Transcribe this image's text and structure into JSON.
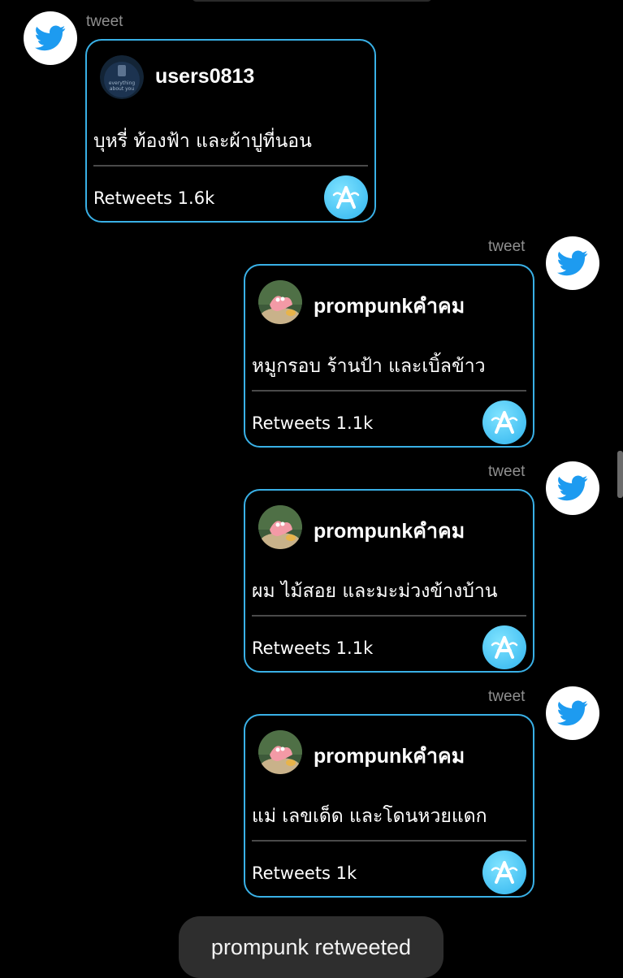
{
  "messages": [
    {
      "sender": "tweet",
      "username": "users0813",
      "text": "บุหรี่ ท้องฟ้า และผ้าปูที่นอน",
      "retweets": "Retweets 1.6k",
      "avatar_icon": "dark-night-avatar"
    },
    {
      "sender": "tweet",
      "username": "prompunkคำคม",
      "text": "หมูกรอบ ร้านป้า และเบิ้ลข้าว",
      "retweets": "Retweets 1.1k",
      "avatar_icon": "patrick-star-avatar"
    },
    {
      "sender": "tweet",
      "username": "prompunkคำคม",
      "text": "ผม ไม้สอย และมะม่วงข้างบ้าน",
      "retweets": "Retweets 1.1k",
      "avatar_icon": "patrick-star-avatar"
    },
    {
      "sender": "tweet",
      "username": "prompunkคำคม",
      "text": "แม่ เลขเด็ด และโดนหวยแดก",
      "retweets": "Retweets 1k",
      "avatar_icon": "patrick-star-avatar"
    }
  ],
  "toast": {
    "text": "prompunk retweeted"
  },
  "colors": {
    "accent": "#39b0e6",
    "twitter_blue": "#1d9bf0",
    "retweet_button": "#2fb3ee"
  }
}
